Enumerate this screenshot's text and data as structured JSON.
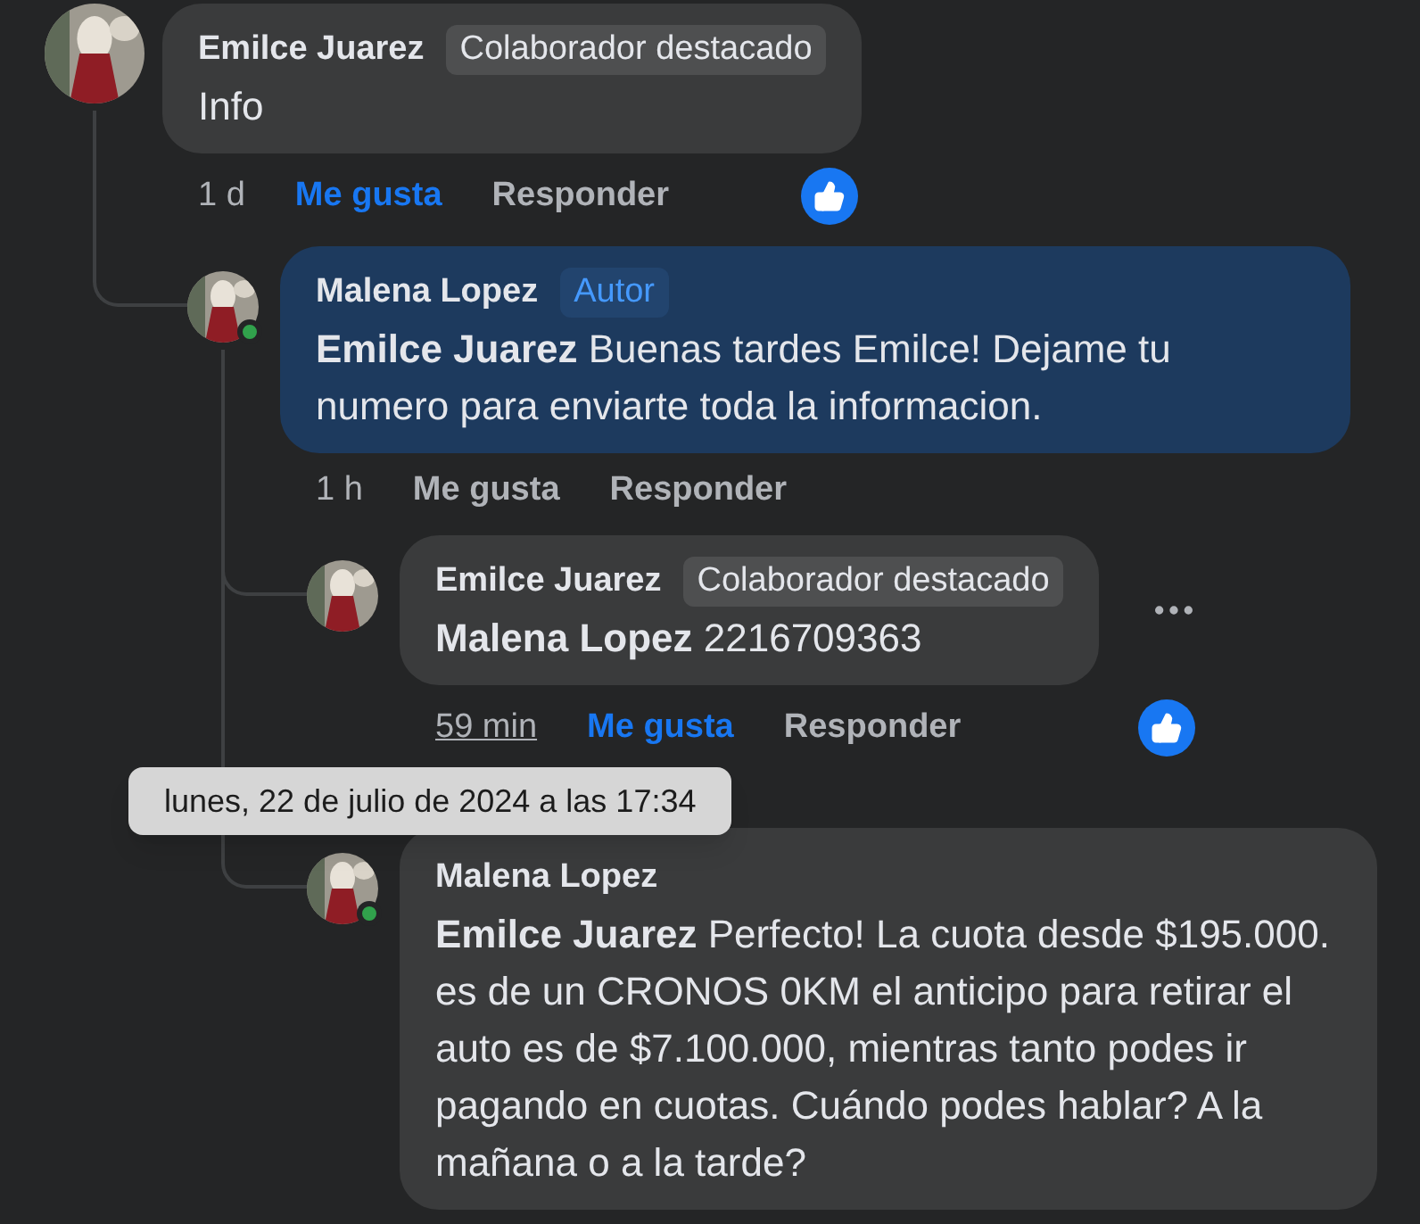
{
  "comments": [
    {
      "author": "Emilce Juarez",
      "badge": {
        "label": "Colaborador destacado",
        "kind": "top_fan"
      },
      "highlighted": false,
      "text": "Info",
      "time": {
        "label": "1 d",
        "hovered": false
      },
      "like_label": "Me gusta",
      "liked": true,
      "reply_label": "Responder",
      "reaction": true,
      "children": [
        {
          "author": "Malena Lopez",
          "badge": {
            "label": "Autor",
            "kind": "author"
          },
          "highlighted": true,
          "mention": "Emilce Juarez",
          "text": "Buenas tardes Emilce! Dejame tu numero para enviarte toda la informacion.",
          "online": true,
          "time": {
            "label": "1 h",
            "hovered": false
          },
          "like_label": "Me gusta",
          "liked": false,
          "reply_label": "Responder",
          "children": [
            {
              "author": "Emilce Juarez",
              "badge": {
                "label": "Colaborador destacado",
                "kind": "top_fan"
              },
              "highlighted": false,
              "mention": "Malena Lopez",
              "text": "2216709363",
              "time": {
                "label": "59 min",
                "hovered": true
              },
              "like_label": "Me gusta",
              "liked": true,
              "reply_label": "Responder",
              "reaction": true,
              "more_menu": true
            },
            {
              "author": "Malena Lopez",
              "highlighted": false,
              "mention": "Emilce Juarez",
              "text": "Perfecto! La cuota desde $195.000. es de un CRONOS 0KM el anticipo para retirar el auto es de $7.100.000, mientras tanto podes ir pagando en cuotas. Cuándo podes hablar? A la mañana o a la tarde?",
              "online": true
            }
          ]
        }
      ]
    }
  ],
  "tooltip": {
    "text": "lunes, 22 de julio de 2024 a las 17:34"
  }
}
